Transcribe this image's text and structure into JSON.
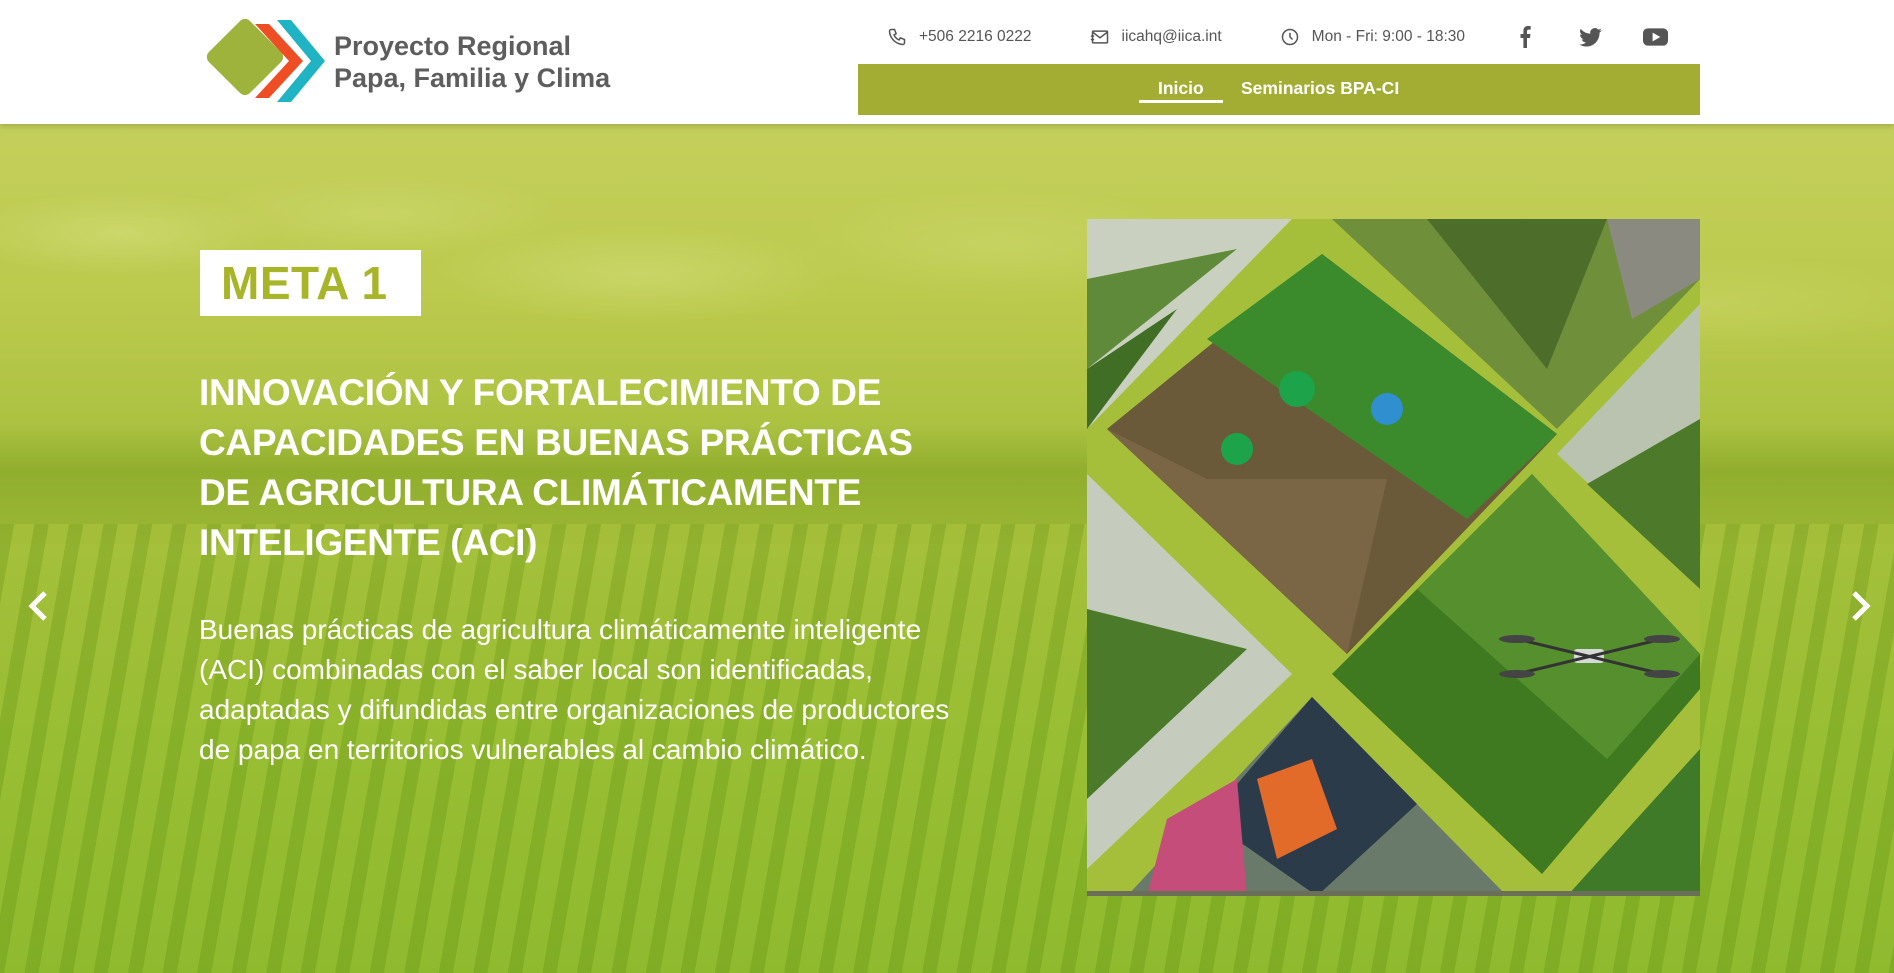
{
  "site": {
    "title_line1": "Proyecto Regional",
    "title_line2": "Papa, Familia y Clima"
  },
  "contact": {
    "phone": "+506 2216 0222",
    "email": "iicahq@iica.int",
    "hours": "Mon - Fri: 9:00 - 18:30"
  },
  "social": [
    "facebook-icon",
    "twitter-icon",
    "youtube-icon"
  ],
  "nav": {
    "items": [
      {
        "label": "Inicio",
        "active": true
      },
      {
        "label": "Seminarios BPA-CI",
        "active": false
      }
    ]
  },
  "hero": {
    "badge": "META 1",
    "title": "INNOVACIÓN Y FORTALECIMIENTO DE CAPACIDADES EN BUENAS PRÁCTICAS DE AGRICULTURA CLIMÁTICAMENTE INTELIGENTE (ACI)",
    "text": "Buenas prácticas de agricultura climáticamente inteligente (ACI) combinadas con el saber local son identificadas, adaptadas y difundidas entre organizaciones de productores de papa en territorios vulnerables al cambio climático."
  },
  "colors": {
    "brand_green": "#a3ad34",
    "badge_text": "#a8b528",
    "logo_text": "#5d5d5d",
    "logo_orange": "#ef4d23",
    "logo_teal": "#1fb3c3"
  }
}
